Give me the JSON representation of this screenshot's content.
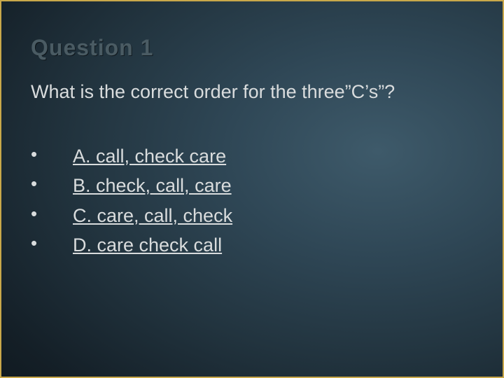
{
  "title": "Question 1",
  "prompt": "What is the correct order for the three”C’s”?",
  "answers": [
    {
      "text": "A. call, check care"
    },
    {
      "text": "B. check, call, care"
    },
    {
      "text": "C. care, call, check"
    },
    {
      "text": "D. care check call"
    }
  ],
  "bullet": "•"
}
